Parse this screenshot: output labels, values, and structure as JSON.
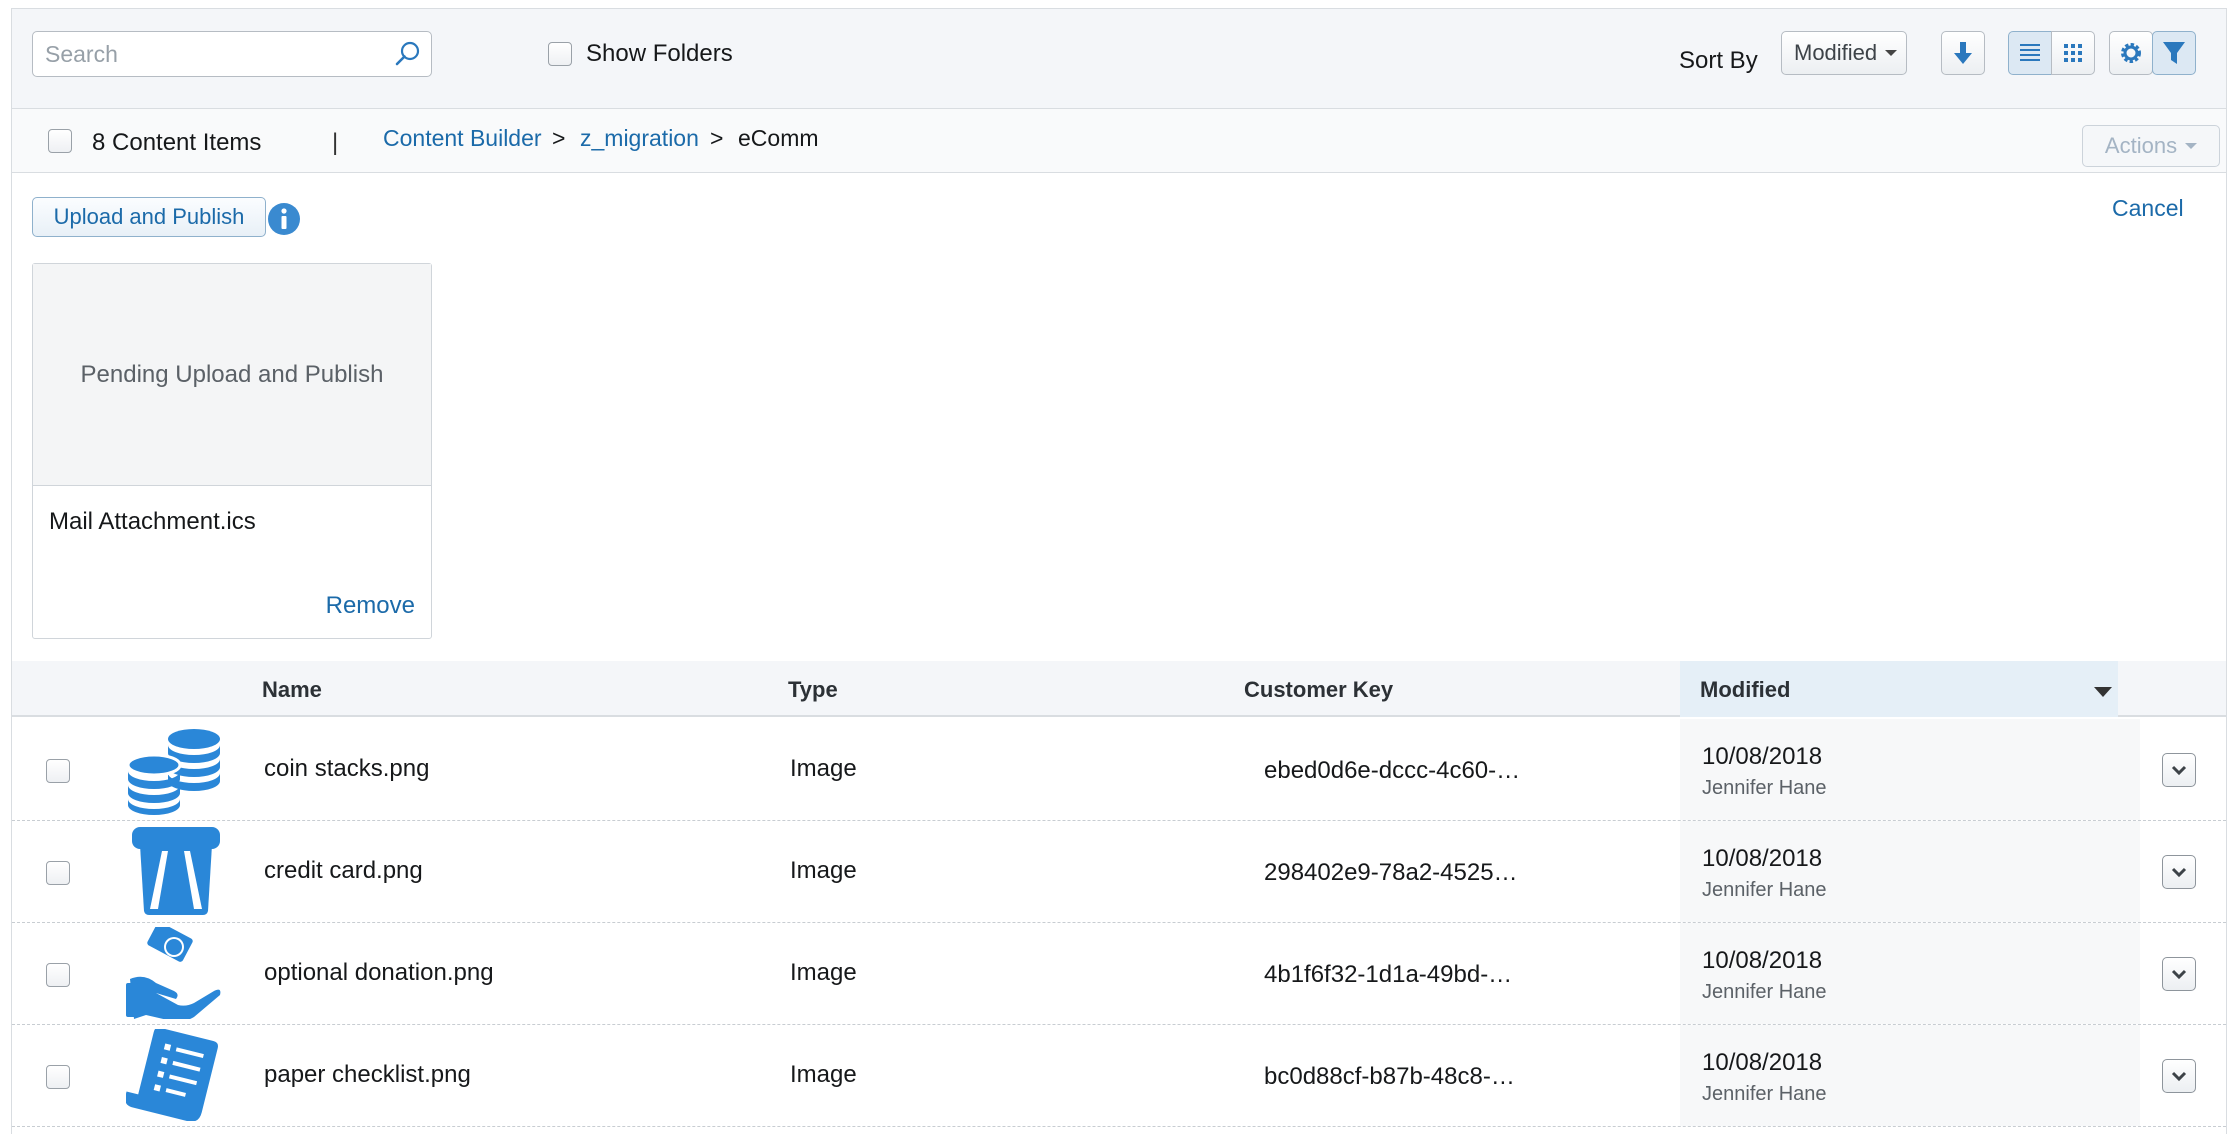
{
  "toolbar": {
    "search_placeholder": "Search",
    "show_folders_label": "Show Folders",
    "sort_by_label": "Sort By",
    "sort_value": "Modified"
  },
  "header": {
    "count_label": "8 Content Items",
    "separator": "|",
    "breadcrumb": [
      "Content Builder",
      ">",
      "z_migration",
      ">",
      "eComm"
    ],
    "actions_label": "Actions"
  },
  "upload": {
    "button_label": "Upload and Publish",
    "cancel_label": "Cancel",
    "pending_label": "Pending Upload and Publish",
    "file_name": "Mail Attachment.ics",
    "remove_label": "Remove"
  },
  "table": {
    "columns": [
      "Name",
      "Type",
      "Customer Key",
      "Modified"
    ],
    "rows": [
      {
        "icon": "coin-stacks-icon",
        "name": "coin stacks.png",
        "type": "Image",
        "key": "ebed0d6e-dccc-4c60-…",
        "date": "10/08/2018",
        "by": "Jennifer Hane"
      },
      {
        "icon": "credit-card-icon",
        "name": "credit card.png",
        "type": "Image",
        "key": "298402e9-78a2-4525…",
        "date": "10/08/2018",
        "by": "Jennifer Hane"
      },
      {
        "icon": "donation-icon",
        "name": "optional donation.png",
        "type": "Image",
        "key": "4b1f6f32-1d1a-49bd-…",
        "date": "10/08/2018",
        "by": "Jennifer Hane"
      },
      {
        "icon": "paper-checklist-icon",
        "name": "paper checklist.png",
        "type": "Image",
        "key": "bc0d88cf-b87b-48c8-…",
        "date": "10/08/2018",
        "by": "Jennifer Hane"
      }
    ]
  },
  "colors": {
    "accent": "#1b6aa9",
    "icon_blue": "#2a87d8",
    "toolbar_bg": "#f4f6f9"
  }
}
